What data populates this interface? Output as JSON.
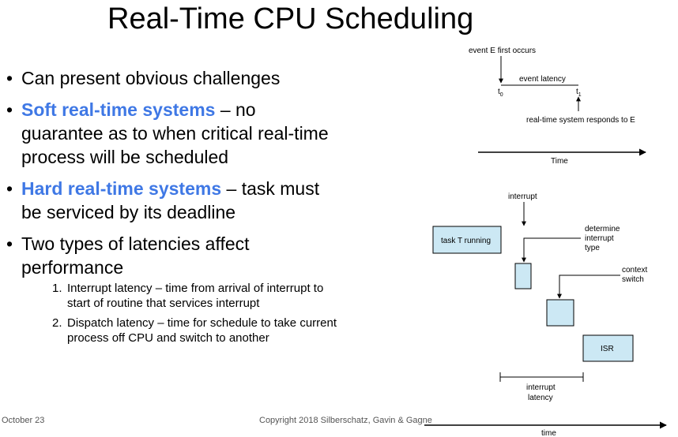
{
  "slide": {
    "title": "Real-Time CPU Scheduling",
    "bullets": [
      {
        "text": "Can present obvious challenges"
      },
      {
        "highlight": "Soft real-time systems",
        "text": " – no guarantee as to when critical real-time process will be scheduled"
      },
      {
        "highlight": "Hard real-time systems",
        "text": " – task must be serviced by its deadline"
      },
      {
        "text": "Two types of latencies affect performance"
      }
    ],
    "subitems": [
      {
        "num": "1.",
        "text": "Interrupt latency – time from arrival of interrupt to start of routine that services interrupt"
      },
      {
        "num": "2.",
        "text": "Dispatch latency – time for schedule to take current process off CPU and switch to another"
      }
    ],
    "bullet_glyph": "•",
    "footer": {
      "date": "October 23",
      "copyright": "Copyright 2018 Silberschatz, Gavin & Gagne"
    }
  },
  "diagram_event": {
    "event_label": "event E first occurs",
    "latency_label": "event latency",
    "t0": "t",
    "t0_sub": "0",
    "t1": "t",
    "t1_sub": "1",
    "response_label": "real-time system responds to E",
    "axis_label": "Time"
  },
  "diagram_interrupt": {
    "interrupt_label": "interrupt",
    "task_label": "task T running",
    "determine_label": [
      "determine",
      "interrupt",
      "type"
    ],
    "context_label": [
      "context",
      "switch"
    ],
    "isr_label": "ISR",
    "latency_label": [
      "interrupt",
      "latency"
    ],
    "axis_label": "time",
    "box_fill": "#cce8f4"
  }
}
